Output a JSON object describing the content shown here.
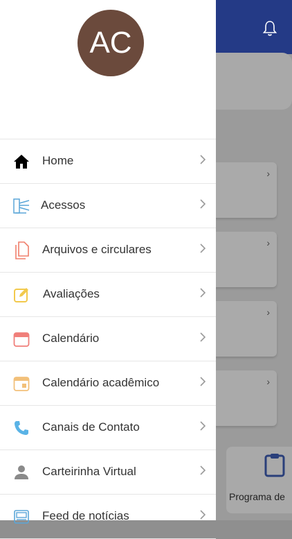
{
  "avatar": {
    "initials": "AC",
    "color": "#6b4a3c"
  },
  "background_app": {
    "header_color": "#243a86",
    "tile_label": "Programa de"
  },
  "menu": {
    "items": [
      {
        "label": "Home",
        "icon": "home-icon"
      },
      {
        "label": "Acessos",
        "icon": "turnstile-icon"
      },
      {
        "label": "Arquivos e circulares",
        "icon": "document-icon"
      },
      {
        "label": "Avaliações",
        "icon": "edit-note-icon"
      },
      {
        "label": "Calendário",
        "icon": "calendar-icon"
      },
      {
        "label": "Calendário acadêmico",
        "icon": "calendar-event-icon"
      },
      {
        "label": "Canais de Contato",
        "icon": "phone-icon"
      },
      {
        "label": "Carteirinha Virtual",
        "icon": "person-icon"
      },
      {
        "label": "Feed de notícias",
        "icon": "news-icon"
      }
    ]
  }
}
